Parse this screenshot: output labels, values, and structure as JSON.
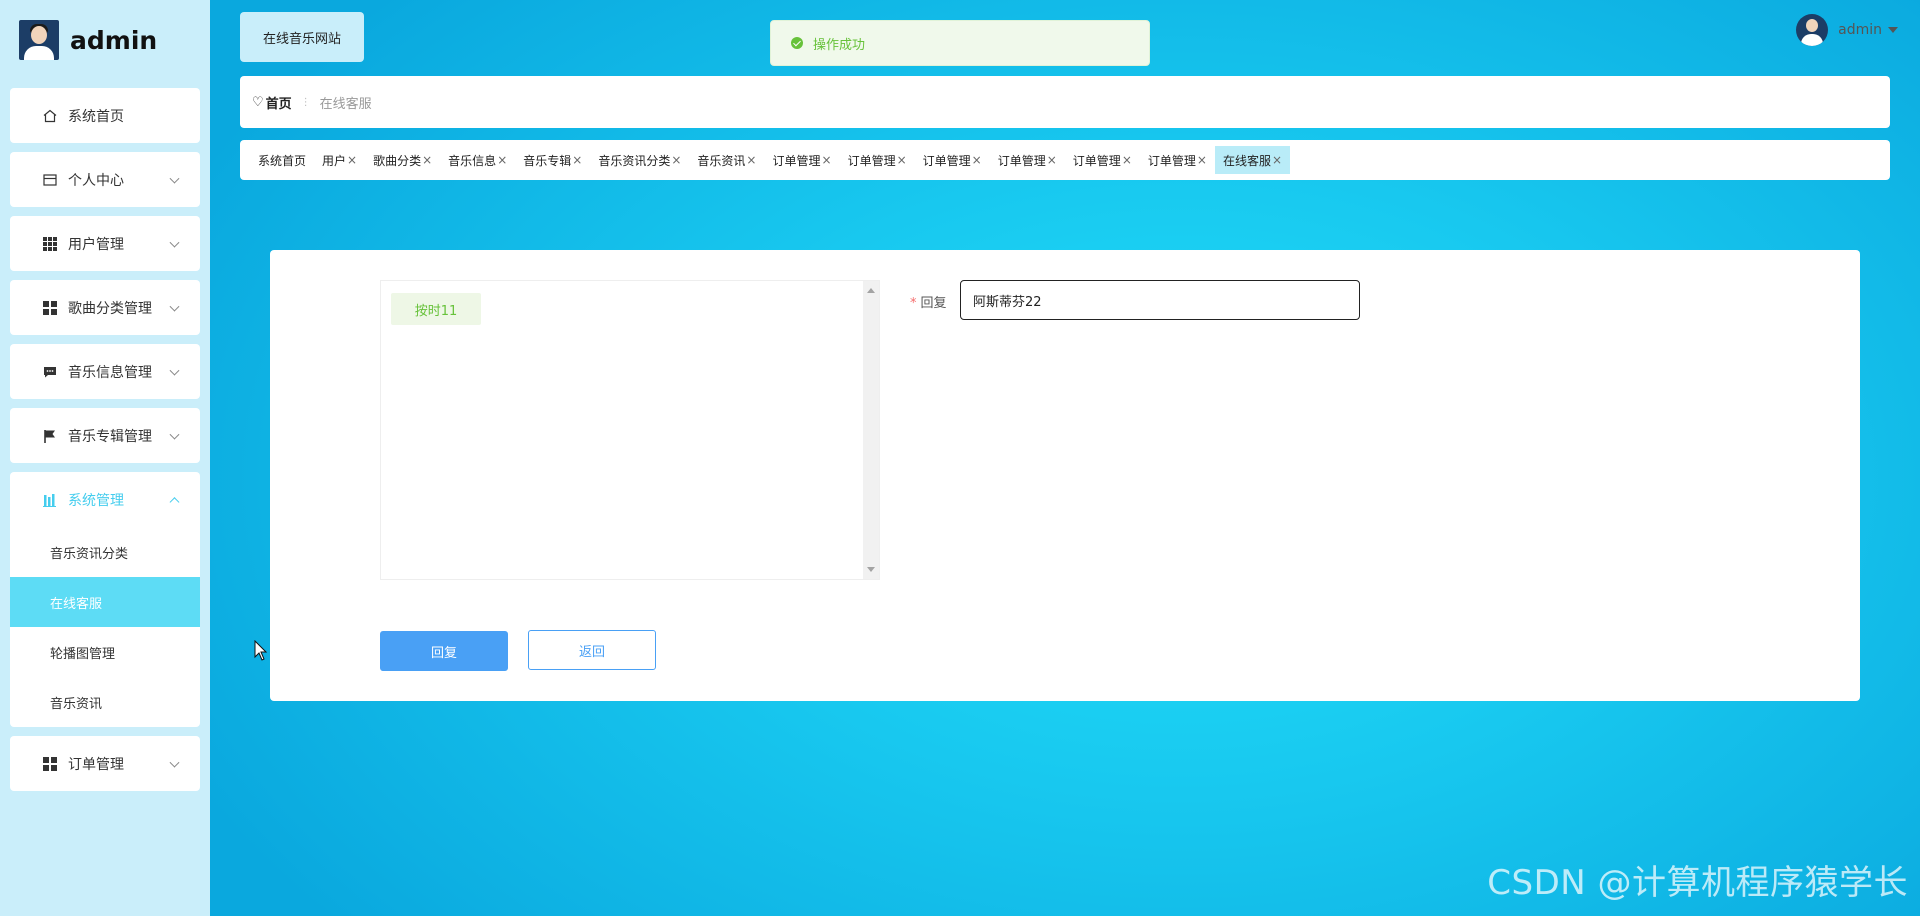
{
  "brand": {
    "title": "admin"
  },
  "site_tag": "在线音乐网站",
  "toast": {
    "message": "操作成功"
  },
  "user": {
    "name": "admin"
  },
  "breadcrumb": {
    "home": "首页",
    "current": "在线客服"
  },
  "sidebar": {
    "items": [
      {
        "label": "系统首页",
        "icon": "home-icon"
      },
      {
        "label": "个人中心",
        "icon": "calendar-icon"
      },
      {
        "label": "用户管理",
        "icon": "grid-icon"
      },
      {
        "label": "歌曲分类管理",
        "icon": "grid-icon"
      },
      {
        "label": "音乐信息管理",
        "icon": "message-icon"
      },
      {
        "label": "音乐专辑管理",
        "icon": "flag-icon"
      },
      {
        "label": "系统管理",
        "icon": "bar-chart-icon"
      },
      {
        "label": "订单管理",
        "icon": "grid-icon"
      }
    ],
    "system_sub": [
      {
        "label": "音乐资讯分类"
      },
      {
        "label": "在线客服"
      },
      {
        "label": "轮播图管理"
      },
      {
        "label": "音乐资讯"
      }
    ]
  },
  "tags": [
    {
      "label": "系统首页",
      "closable": false
    },
    {
      "label": "用户",
      "closable": true
    },
    {
      "label": "歌曲分类",
      "closable": true
    },
    {
      "label": "音乐信息",
      "closable": true
    },
    {
      "label": "音乐专辑",
      "closable": true
    },
    {
      "label": "音乐资讯分类",
      "closable": true
    },
    {
      "label": "音乐资讯",
      "closable": true
    },
    {
      "label": "订单管理",
      "closable": true
    },
    {
      "label": "订单管理",
      "closable": true
    },
    {
      "label": "订单管理",
      "closable": true
    },
    {
      "label": "订单管理",
      "closable": true
    },
    {
      "label": "订单管理",
      "closable": true
    },
    {
      "label": "订单管理",
      "closable": true
    },
    {
      "label": "在线客服",
      "closable": true,
      "active": true
    }
  ],
  "tag_close_glyph": "×",
  "chat": {
    "messages": [
      {
        "text": "按时11"
      }
    ]
  },
  "form": {
    "reply_label": "回复",
    "required_mark": "*",
    "reply_value": "阿斯蒂芬22"
  },
  "buttons": {
    "reply": "回复",
    "back": "返回"
  },
  "watermark": "CSDN @计算机程序猿学长",
  "colors": {
    "accent": "#45cdee",
    "active_bg": "#5ddcf5",
    "primary": "#49a0f5",
    "success": "#67c23a"
  }
}
